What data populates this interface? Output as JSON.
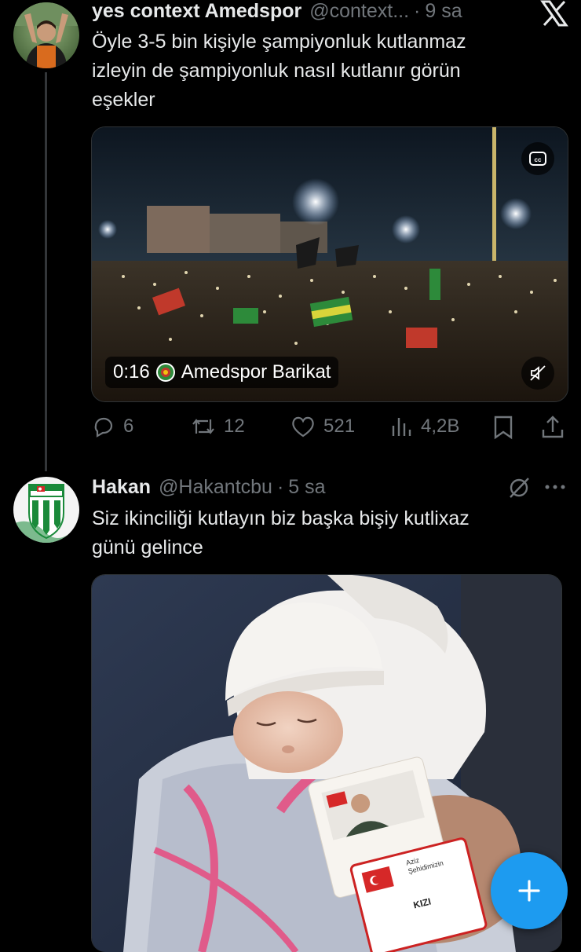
{
  "tweet1": {
    "display_name": "yes context Amedspor",
    "handle": "@context...",
    "time": "9 sa",
    "text_lines": [
      "Öyle 3-5 bin kişiyle şampiyonluk kutlanmaz",
      "izleyin de şampiyonluk nasıl kutlanır görün",
      "eşekler"
    ],
    "video": {
      "duration": "0:16",
      "source_name": "Amedspor Barikat"
    },
    "actions": {
      "replies": "6",
      "reposts": "12",
      "likes": "521",
      "views": "4,2B"
    }
  },
  "tweet2": {
    "display_name": "Hakan",
    "handle": "@Hakantcbu",
    "time": "5 sa",
    "text_lines": [
      "Siz ikinciliği kutlayın biz başka bişiy kutlixaz",
      "günü gelince"
    ],
    "card_text": {
      "line1": "Aziz",
      "line2": "Şehidimizin",
      "line3": "KIZI"
    }
  },
  "colors": {
    "accent": "#1d9bf0",
    "muted": "#71767b",
    "text": "#e7e9ea",
    "background": "#000000"
  },
  "icons": [
    "x-logo-icon",
    "cc-icon",
    "mute-icon",
    "reply-icon",
    "repost-icon",
    "like-icon",
    "views-icon",
    "bookmark-icon",
    "share-icon",
    "grok-icon",
    "more-icon",
    "compose-plus-icon"
  ]
}
